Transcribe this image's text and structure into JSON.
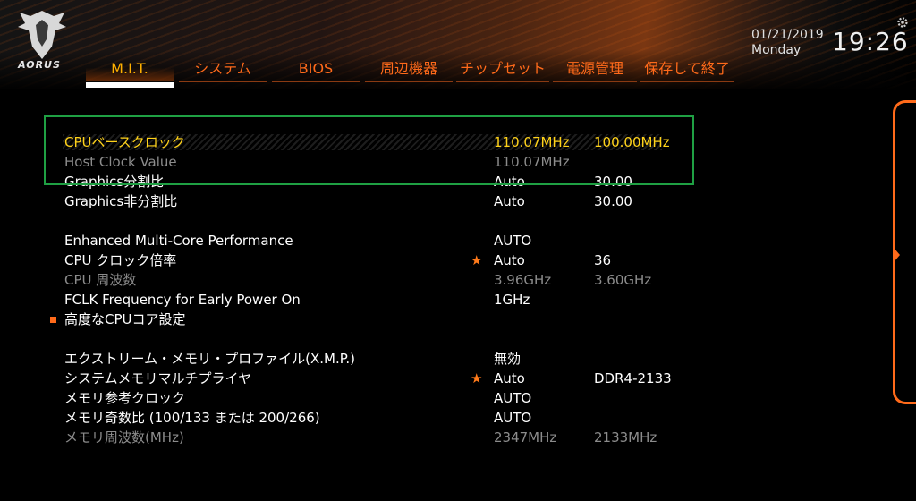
{
  "brand": {
    "logo_text": "AORUS"
  },
  "header": {
    "date": "01/21/2019",
    "day": "Monday",
    "time": "19:26"
  },
  "tabs": [
    {
      "label": "M.I.T.",
      "active": true
    },
    {
      "label": "システム",
      "active": false
    },
    {
      "label": "BIOS",
      "active": false
    },
    {
      "label": "周辺機器",
      "active": false
    },
    {
      "label": "チップセット",
      "active": false
    },
    {
      "label": "電源管理",
      "active": false
    },
    {
      "label": "保存して終了",
      "active": false
    }
  ],
  "settings": [
    {
      "label": "CPUベースクロック",
      "value1": "110.07MHz",
      "value2": "100.00MHz",
      "state": "selected",
      "star": false
    },
    {
      "label": "Host Clock Value",
      "value1": "110.07MHz",
      "value2": "",
      "state": "dim",
      "star": false
    },
    {
      "label": "Graphics分割比",
      "value1": "Auto",
      "value2": "30.00",
      "state": "normal",
      "star": false
    },
    {
      "label": "Graphics非分割比",
      "value1": "Auto",
      "value2": "30.00",
      "state": "normal",
      "star": false
    },
    {
      "label": "Enhanced Multi-Core Performance",
      "value1": "AUTO",
      "value2": "",
      "state": "normal",
      "star": false
    },
    {
      "label": "CPU クロック倍率",
      "value1": "Auto",
      "value2": "36",
      "state": "normal",
      "star": true
    },
    {
      "label": "CPU 周波数",
      "value1": "3.96GHz",
      "value2": "3.60GHz",
      "state": "dim",
      "star": false
    },
    {
      "label": "FCLK Frequency for Early Power On",
      "value1": "1GHz",
      "value2": "",
      "state": "normal",
      "star": false
    },
    {
      "label": "高度なCPUコア設定",
      "value1": "",
      "value2": "",
      "state": "submenu",
      "star": false
    },
    {
      "label": "エクストリーム・メモリ・プロファイル(X.M.P.)",
      "value1": "無効",
      "value2": "",
      "state": "normal",
      "star": false
    },
    {
      "label": "システムメモリマルチプライヤ",
      "value1": "Auto",
      "value2": "DDR4-2133",
      "state": "normal",
      "star": true
    },
    {
      "label": "メモリ参考クロック",
      "value1": "AUTO",
      "value2": "",
      "state": "normal",
      "star": false
    },
    {
      "label": "メモリ奇数比 (100/133 または 200/266)",
      "value1": "AUTO",
      "value2": "",
      "state": "normal",
      "star": false
    },
    {
      "label": "メモリ周波数(MHz)",
      "value1": "2347MHz",
      "value2": "2133MHz",
      "state": "dim",
      "star": false
    }
  ],
  "colors": {
    "accent": "#ff6a1a",
    "active_tab": "#ffb000",
    "selected_text": "#ffd21a",
    "highlight_box": "#1fa043",
    "dim_text": "#8c8c8c"
  },
  "icons": {
    "logo": "aorus-eagle-icon",
    "star": "star-icon",
    "gear": "gear-icon",
    "sidebar_arrow": "chevron-right-icon"
  }
}
